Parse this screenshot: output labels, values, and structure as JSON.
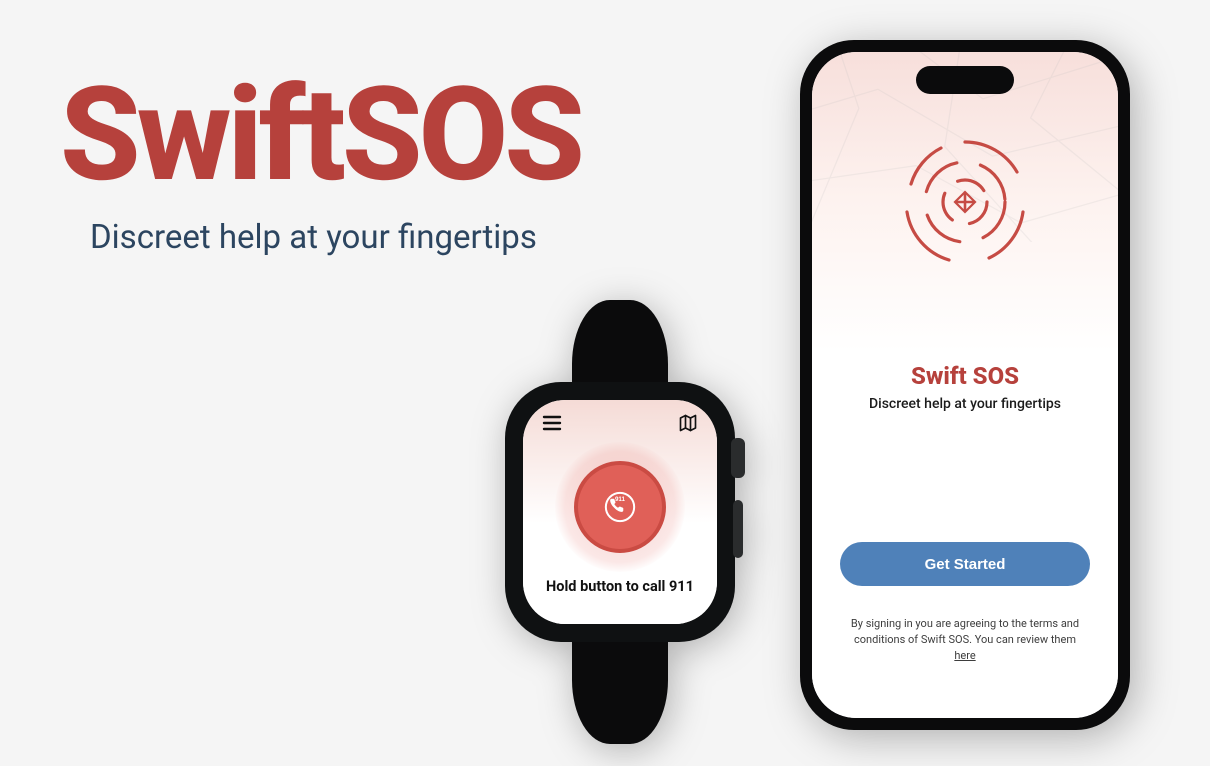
{
  "hero": {
    "title": "SwiftSOS",
    "tagline": "Discreet help at your fingertips"
  },
  "phone": {
    "title": "Swift SOS",
    "subtitle": "Discreet help at your fingertips",
    "cta": "Get Started",
    "terms_prefix": "By signing in you are agreeing to the terms and conditions of Swift SOS. You can review them ",
    "terms_link": "here"
  },
  "watch": {
    "hint": "Hold button to call 911",
    "sos_badge": "911"
  },
  "colors": {
    "brand_red": "#b6413c",
    "accent_red": "#e06058",
    "blue": "#4f81b9",
    "navy": "#2c4560"
  }
}
